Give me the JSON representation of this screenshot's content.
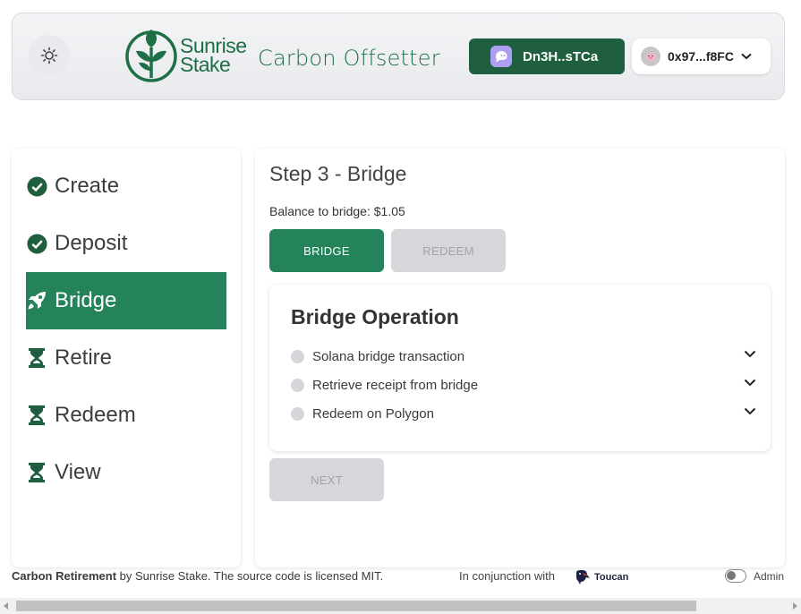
{
  "header": {
    "brand_line1": "Sunrise",
    "brand_line2": "Stake",
    "app_title": "Carbon Offsetter",
    "solana_wallet": "Dn3H..sTCa",
    "eth_wallet": "0x97...f8FC"
  },
  "sidebar": {
    "items": [
      {
        "label": "Create",
        "icon": "check-circle-icon",
        "state": "done"
      },
      {
        "label": "Deposit",
        "icon": "check-circle-icon",
        "state": "done"
      },
      {
        "label": "Bridge",
        "icon": "rocket-icon",
        "state": "active"
      },
      {
        "label": "Retire",
        "icon": "hourglass-icon",
        "state": "pending"
      },
      {
        "label": "Redeem",
        "icon": "hourglass-icon",
        "state": "pending"
      },
      {
        "label": "View",
        "icon": "hourglass-icon",
        "state": "pending"
      }
    ]
  },
  "main": {
    "step_title": "Step 3 - Bridge",
    "balance_text": "Balance to bridge: $1.05",
    "bridge_button": "BRIDGE",
    "redeem_button": "REDEEM",
    "next_button": "NEXT",
    "operation": {
      "title": "Bridge Operation",
      "steps": [
        "Solana bridge transaction",
        "Retrieve receipt from bridge",
        "Redeem on Polygon"
      ]
    }
  },
  "footer": {
    "bold_text": "Carbon Retirement",
    "rest_text": " by Sunrise Stake. The source code is licensed MIT.",
    "conjunction_text": "In conjunction with",
    "partner": "Toucan",
    "admin_label": "Admin"
  },
  "colors": {
    "brand_green": "#1f6f46",
    "active_green": "#24835a",
    "wallet_dark_green": "#1f5e3f",
    "disabled_gray": "#d6d7da"
  }
}
